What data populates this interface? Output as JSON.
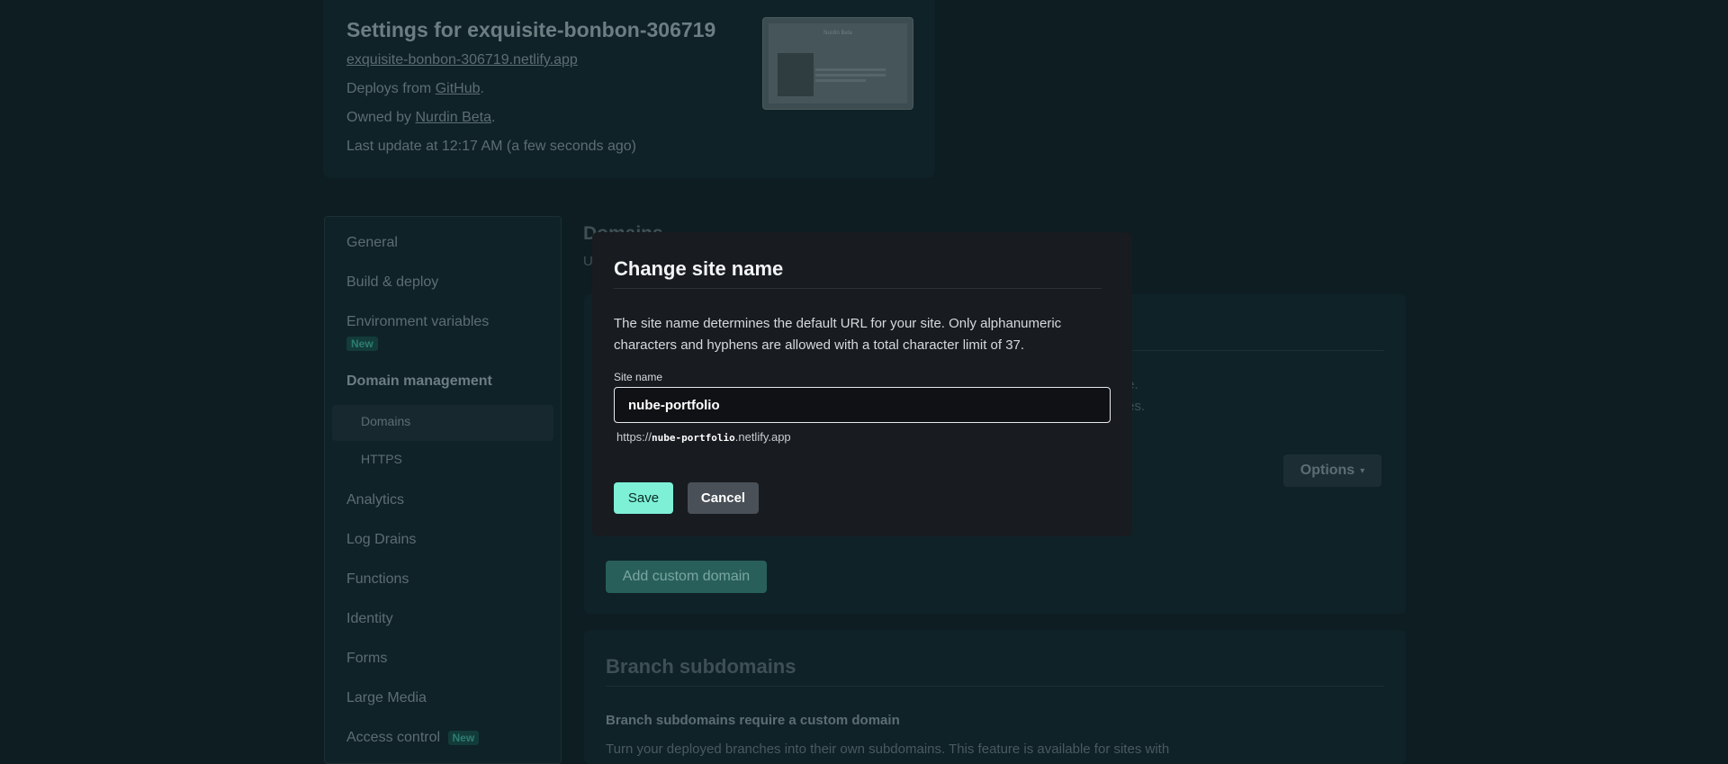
{
  "site": {
    "title": "Settings for exquisite-bonbon-306719",
    "url": "exquisite-bonbon-306719.netlify.app",
    "deploys_prefix": "Deploys from",
    "deploys_source": "GitHub",
    "owned_prefix": "Owned by",
    "owner": "Nurdin Beta",
    "last_update": "Last update at 12:17 AM (a few seconds ago)",
    "thumb_heading": "Nurdin Beta"
  },
  "sidebar": {
    "general": "General",
    "build_deploy": "Build & deploy",
    "env_vars": "Environment variables",
    "env_badge": "New",
    "domain_mgmt": "Domain management",
    "domains": "Domains",
    "https": "HTTPS",
    "analytics": "Analytics",
    "log_drains": "Log Drains",
    "functions": "Functions",
    "identity": "Identity",
    "forms": "Forms",
    "large_media": "Large Media",
    "access_control": "Access control",
    "access_badge": "New"
  },
  "main": {
    "heading": "Domains",
    "subheading": "U",
    "panel_text_1": "name.",
    "panel_text_2": "names.",
    "options_label": "Options",
    "add_domain_label": "Add custom domain",
    "branch_title": "Branch subdomains",
    "branch_bold": "Branch subdomains require a custom domain",
    "branch_text": "Turn your deployed branches into their own subdomains. This feature is available for sites with"
  },
  "modal": {
    "title": "Change site name",
    "description": "The site name determines the default URL for your site. Only alphanumeric characters and hyphens are allowed with a total character limit of 37.",
    "field_label": "Site name",
    "field_value": "nube-portfolio",
    "url_prefix": "https://",
    "url_name": "nube-portfolio",
    "url_suffix": ".netlify.app",
    "save_label": "Save",
    "cancel_label": "Cancel"
  }
}
